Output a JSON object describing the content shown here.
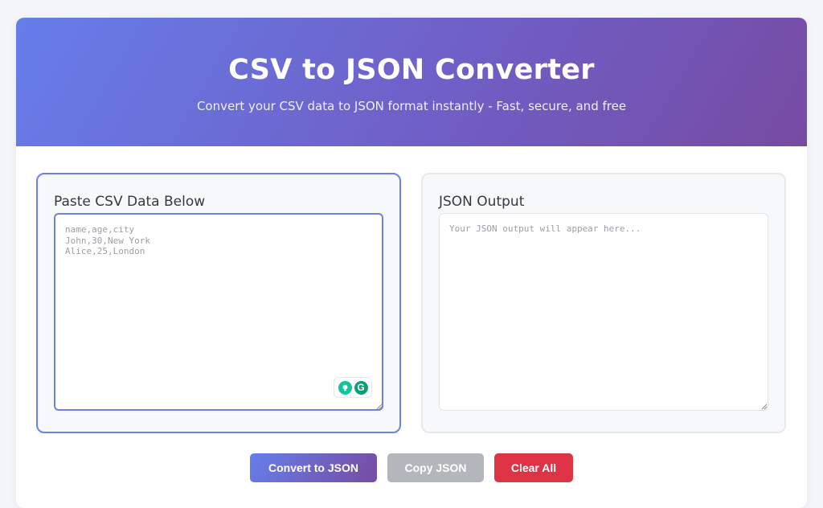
{
  "header": {
    "title": "CSV to JSON Converter",
    "subtitle": "Convert your CSV data to JSON format instantly - Fast, secure, and free"
  },
  "input_panel": {
    "title": "Paste CSV Data Below",
    "placeholder": "name,age,city\nJohn,30,New York\nAlice,25,London",
    "value": ""
  },
  "output_panel": {
    "title": "JSON Output",
    "placeholder": "Your JSON output will appear here...",
    "value": ""
  },
  "buttons": {
    "convert": "Convert to JSON",
    "copy": "Copy JSON",
    "clear": "Clear All"
  },
  "icons": {
    "grammarly_suggestion": "lightbulb-icon",
    "grammarly_logo": "grammarly-g-icon"
  },
  "colors": {
    "accent_start": "#667eea",
    "accent_end": "#764ba2",
    "copy_button": "#b3b6bb",
    "clear_button": "#dd3344"
  }
}
